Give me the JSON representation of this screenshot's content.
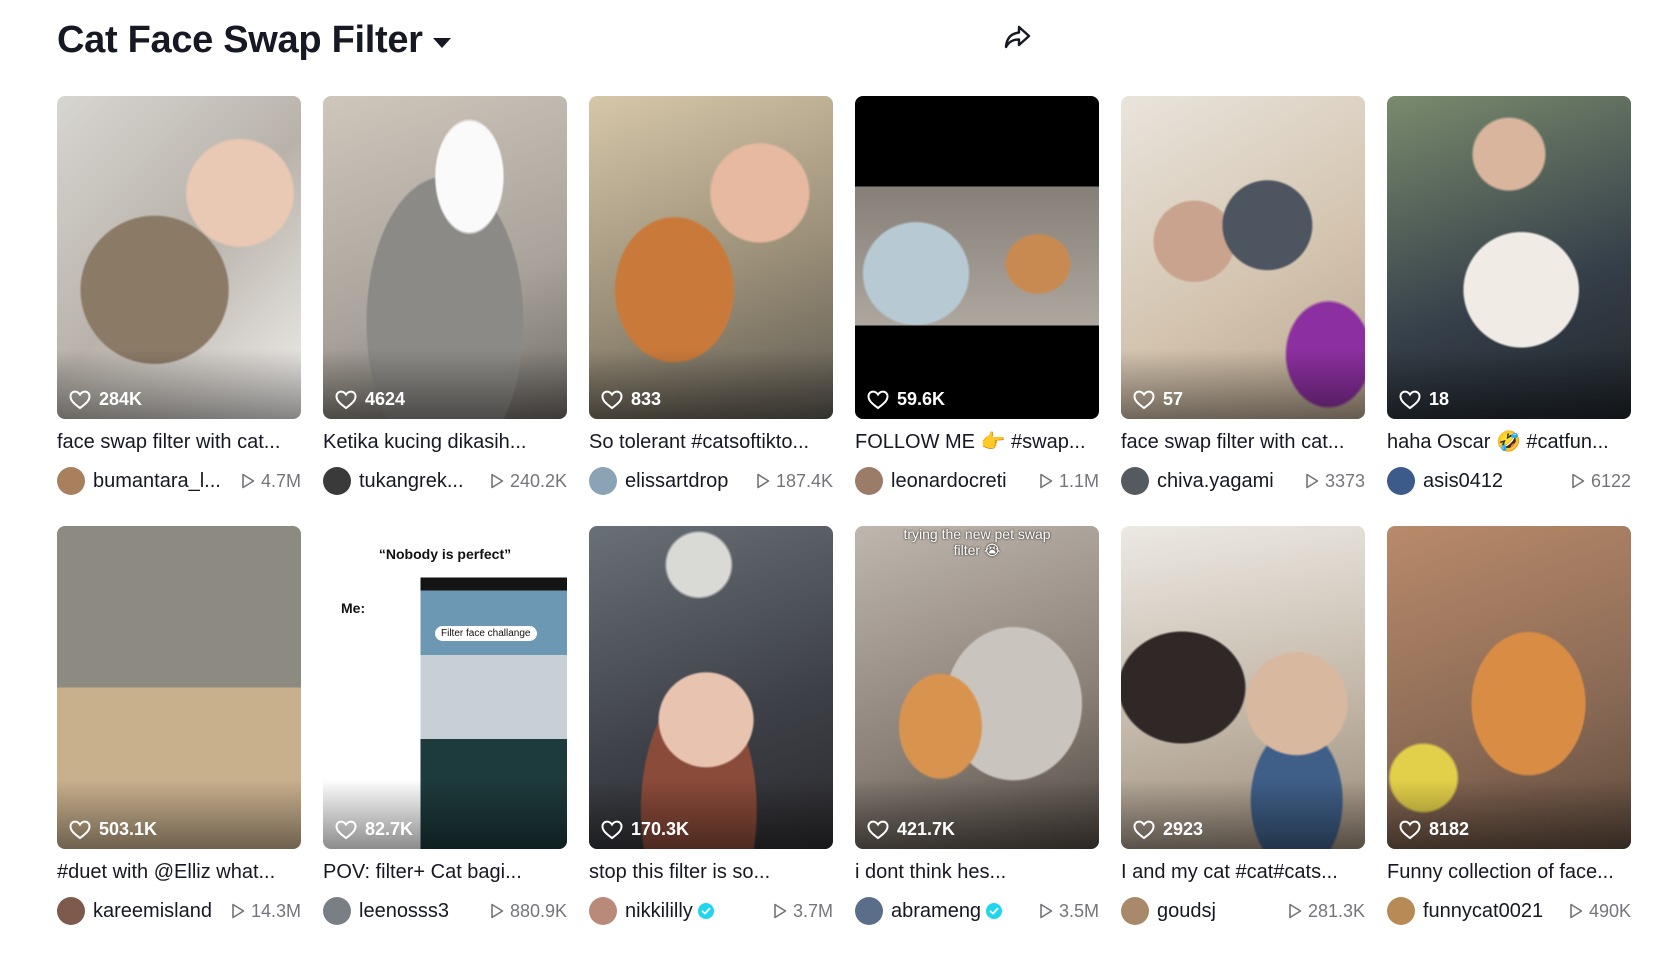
{
  "header": {
    "title": "Cat Face Swap Filter"
  },
  "share_icon": "share-arrow-icon",
  "videos": [
    {
      "likes": "284K",
      "caption": "face swap filter with cat...",
      "author": "bumantara_l...",
      "views": "4.7M",
      "verified": false,
      "avatar_color": "#a9805e",
      "thumb_overlay": ""
    },
    {
      "likes": "4624",
      "caption": "Ketika kucing dikasih...",
      "author": "tukangrek...",
      "views": "240.2K",
      "verified": false,
      "avatar_color": "#3a3a3a",
      "thumb_overlay": ""
    },
    {
      "likes": "833",
      "caption": "So tolerant #catsoftikto...",
      "author": "elissartdrop",
      "views": "187.4K",
      "verified": false,
      "avatar_color": "#8aa3b5",
      "thumb_overlay": ""
    },
    {
      "likes": "59.6K",
      "caption": "FOLLOW ME 👉 #swap...",
      "author": "leonardocreti",
      "views": "1.1M",
      "verified": false,
      "avatar_color": "#9b7c68",
      "thumb_overlay": ""
    },
    {
      "likes": "57",
      "caption": "face swap filter with cat...",
      "author": "chiva.yagami",
      "views": "3373",
      "verified": false,
      "avatar_color": "#555a60",
      "thumb_overlay": ""
    },
    {
      "likes": "18",
      "caption": "haha Oscar 🤣 #catfun...",
      "author": "asis0412",
      "views": "6122",
      "verified": false,
      "avatar_color": "#3c5a8a",
      "thumb_overlay": ""
    },
    {
      "likes": "503.1K",
      "caption": "#duet with @Elliz what...",
      "author": "kareemisland",
      "views": "14.3M",
      "verified": false,
      "avatar_color": "#7d5a4c",
      "thumb_overlay": ""
    },
    {
      "likes": "82.7K",
      "caption": "POV: filter+ Cat bagi...",
      "author": "leenosss3",
      "views": "880.9K",
      "verified": false,
      "avatar_color": "#7a7f86",
      "thumb_overlay": ""
    },
    {
      "likes": "170.3K",
      "caption": "stop this filter is so...",
      "author": "nikkililly",
      "views": "3.7M",
      "verified": true,
      "avatar_color": "#b98a7a",
      "thumb_overlay": ""
    },
    {
      "likes": "421.7K",
      "caption": "i dont think hes...",
      "author": "abrameng",
      "views": "3.5M",
      "verified": true,
      "avatar_color": "#5a6e8a",
      "thumb_overlay": "trying the new pet swap filter 😭"
    },
    {
      "likes": "2923",
      "caption": "I and my cat #cat#cats...",
      "author": "goudsj",
      "views": "281.3K",
      "verified": false,
      "avatar_color": "#a88a6a",
      "thumb_overlay": ""
    },
    {
      "likes": "8182",
      "caption": "Funny collection of face...",
      "author": "funnycat0021",
      "views": "490K",
      "verified": false,
      "avatar_color": "#b88a55",
      "thumb_overlay": ""
    }
  ],
  "pov_thumb": {
    "quote": "“Nobody is perfect”",
    "me": "Me:",
    "chip": "Filter face challange"
  },
  "colors": {
    "text": "#161823",
    "verified_badge": "#20d5ec",
    "secondary": "rgba(22,24,35,0.6)"
  }
}
